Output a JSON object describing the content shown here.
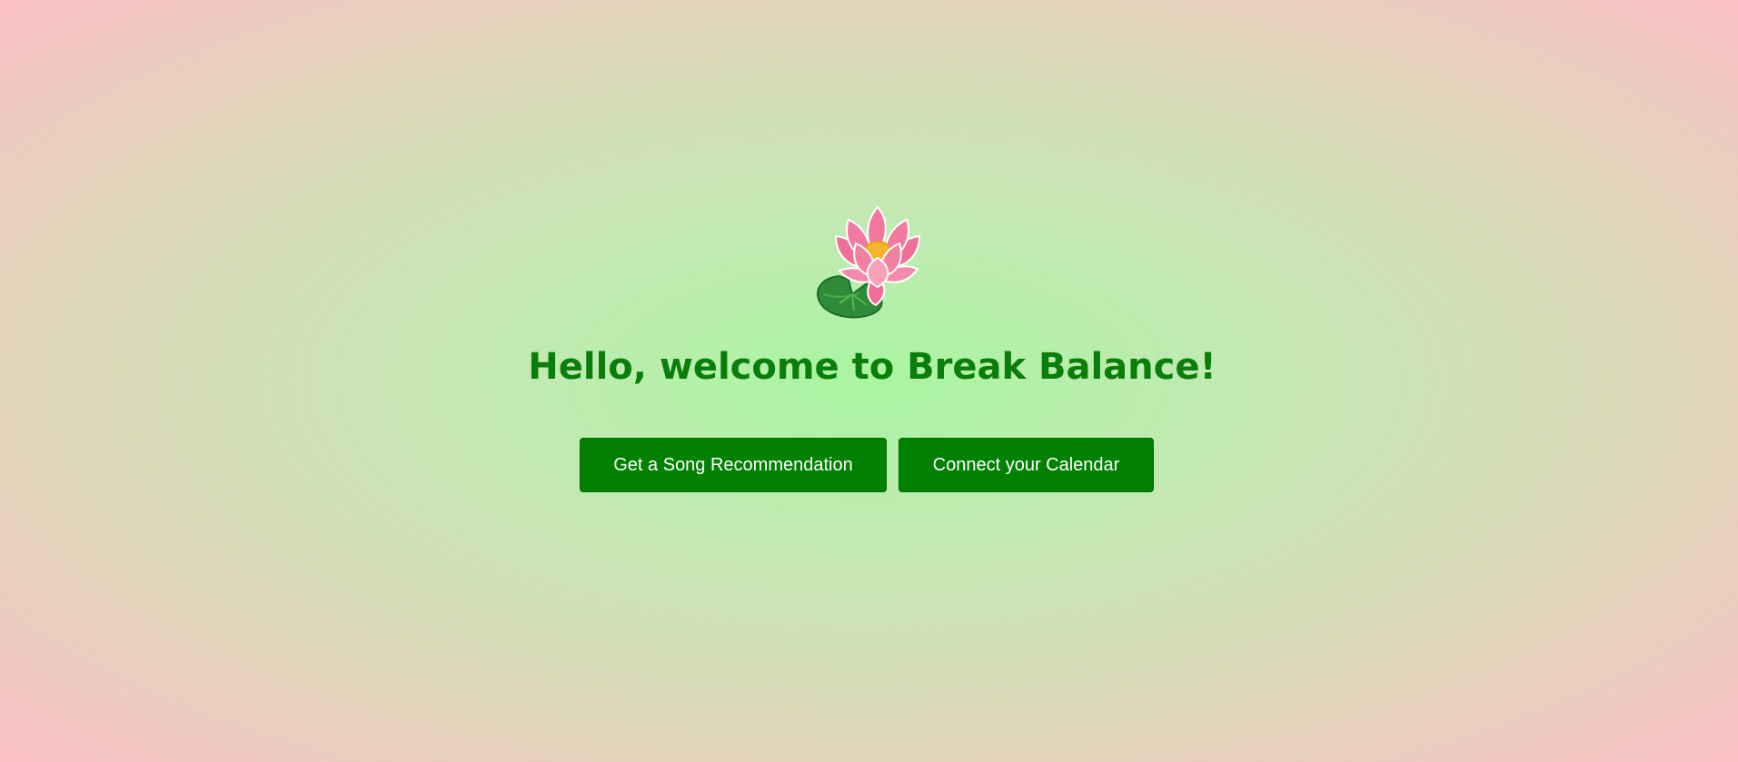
{
  "app": {
    "logo_icon": "lotus-icon",
    "title": "Hello, welcome to Break Balance!",
    "accent_color": "#028002",
    "title_color": "#0a7d0a"
  },
  "actions": {
    "song_label": "Get a Song Recommendation",
    "calendar_label": "Connect your Calendar"
  }
}
